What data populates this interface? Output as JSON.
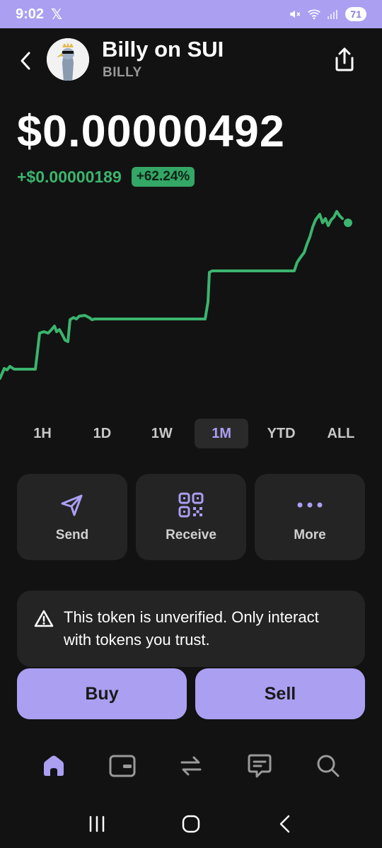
{
  "status": {
    "time": "9:02",
    "app_badge": "𝕏",
    "battery": "71"
  },
  "token": {
    "name": "Billy on SUI",
    "symbol": "BILLY",
    "price": "$0.00000492",
    "change_abs": "+$0.00000189",
    "change_pct": "+62.24%"
  },
  "colors": {
    "accent": "#ab9ff2",
    "positive": "#3bb46e",
    "card": "#242424",
    "background": "#121212"
  },
  "ranges": [
    {
      "label": "1H",
      "active": false
    },
    {
      "label": "1D",
      "active": false
    },
    {
      "label": "1W",
      "active": false
    },
    {
      "label": "1M",
      "active": true
    },
    {
      "label": "YTD",
      "active": false
    },
    {
      "label": "ALL",
      "active": false
    }
  ],
  "actions": {
    "send": {
      "label": "Send",
      "icon": "send-icon"
    },
    "receive": {
      "label": "Receive",
      "icon": "qr-code-icon"
    },
    "more": {
      "label": "More",
      "icon": "more-dots-icon"
    }
  },
  "warning": {
    "icon": "warning-triangle-icon",
    "text": "This token is unverified. Only interact with tokens you trust."
  },
  "trade": {
    "buy": "Buy",
    "sell": "Sell"
  },
  "tabs": [
    {
      "name": "home",
      "icon": "home-icon",
      "active": true
    },
    {
      "name": "collectibles",
      "icon": "wallet-card-icon",
      "active": false
    },
    {
      "name": "swap",
      "icon": "swap-icon",
      "active": false
    },
    {
      "name": "messages",
      "icon": "chat-icon",
      "active": false
    },
    {
      "name": "search",
      "icon": "search-icon",
      "active": false
    }
  ],
  "system_nav": [
    "recent-apps-icon",
    "home-circle-icon",
    "back-icon"
  ]
}
